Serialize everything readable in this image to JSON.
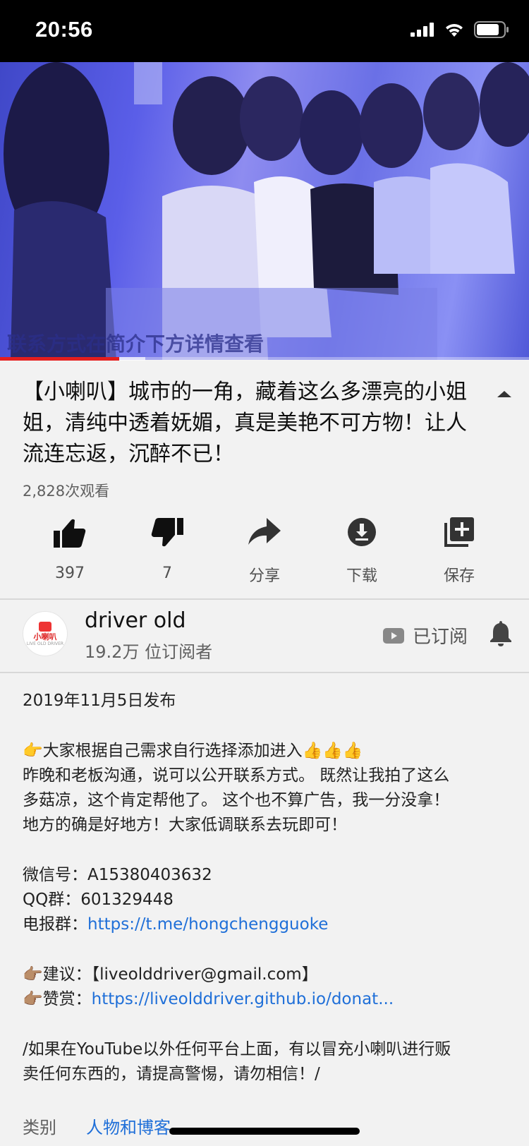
{
  "status_bar": {
    "time": "20:56"
  },
  "video": {
    "overlay_text": "联系方式在简介下方详情查看",
    "progress_fraction": 0.225,
    "buffer_fraction": 0.275,
    "progress_color": "#e61e1e"
  },
  "title": "【小喇叭】城市的一角，藏着这么多漂亮的小姐姐，清纯中透着妩媚，真是美艳不可方物！让人流连忘返，沉醉不已！",
  "views": "2,828次观看",
  "actions": [
    {
      "icon": "thumbs-up-icon",
      "label": "397"
    },
    {
      "icon": "thumbs-down-icon",
      "label": "7"
    },
    {
      "icon": "share-icon",
      "label": "分享"
    },
    {
      "icon": "download-icon",
      "label": "下载"
    },
    {
      "icon": "save-playlist-icon",
      "label": "保存"
    }
  ],
  "channel": {
    "name": "driver old",
    "subscribers": "19.2万 位订阅者",
    "avatar_text": "小喇叭",
    "avatar_subtext": "LIVE OLD DRIVER",
    "subscribed_label": "已订阅"
  },
  "description": {
    "published": "2019年11月5日发布",
    "line1": "👉大家根据自己需求自行选择添加进入👍👍👍",
    "line2": "昨晚和老板沟通，说可以公开联系方式。 既然让我拍了这么",
    "line3": "多菇凉，这个肯定帮他了。 这个也不算广告，我一分没拿！",
    "line4": "地方的确是好地方！大家低调联系去玩即可！",
    "wechat_label": "微信号：",
    "wechat_value": "A15380403632",
    "qq_label": "QQ群：",
    "qq_value": "601329448",
    "telegram_label": "电报群：",
    "telegram_link": "https://t.me/hongchengguoke",
    "suggest_line": "👉🏽建议：【liveolddriver@gmail.com】",
    "donate_label": "👉🏽赞赏：",
    "donate_link": "https://liveolddriver.github.io/donat...",
    "notice_line1": "/如果在YouTube以外任何平台上面，有以冒充小喇叭进行贩",
    "notice_line2": "卖任何东西的，请提高警惕，请勿相信！/"
  },
  "category": {
    "label": "类别",
    "value": "人物和博客"
  }
}
